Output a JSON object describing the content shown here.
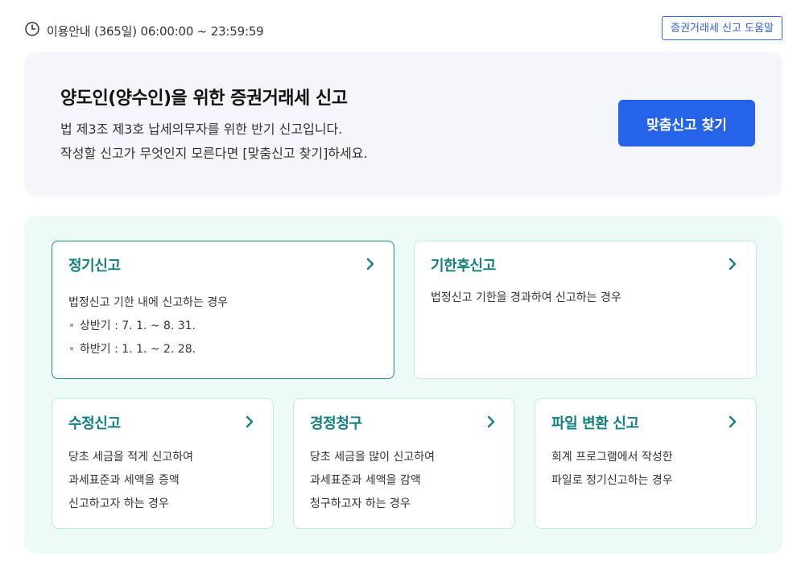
{
  "header": {
    "hours_text": "이용안내 (365일) 06:00:00 ~ 23:59:59",
    "help_button": "증권거래세 신고 도움말"
  },
  "hero": {
    "title": "양도인(양수인)을 위한 증권거래세 신고",
    "desc_line1": "법 제3조 제3호 납세의무자를 위한 반기 신고입니다.",
    "desc_line2": "작성할 신고가 무엇인지 모른다면 [맞춤신고 찾기]하세요.",
    "find_button": "맞춤신고 찾기"
  },
  "cards": [
    {
      "title": "정기신고",
      "lines": [
        "법정신고 기한 내에 신고하는 경우"
      ],
      "bullets": [
        "상반기 : 7. 1. ~ 8. 31.",
        "하반기 : 1. 1. ~ 2. 28."
      ]
    },
    {
      "title": "기한후신고",
      "lines": [
        "법정신고 기한을 경과하여 신고하는 경우"
      ]
    },
    {
      "title": "수정신고",
      "lines": [
        "당초 세금을 적게 신고하여",
        "과세표준과 세액을 증액",
        "신고하고자 하는 경우"
      ]
    },
    {
      "title": "경정청구",
      "lines": [
        "당초 세금을 많이 신고하여",
        "과세표준과 세액을 감액",
        "청구하고자 하는 경우"
      ]
    },
    {
      "title": "파일 변환 신고",
      "lines": [
        "회계 프로그램에서 작성한",
        "파일로 정기신고하는 경우"
      ]
    }
  ],
  "colors": {
    "accent_blue": "#2563e8",
    "card_title_teal": "#12807e",
    "panel_bg": "#eefaf8",
    "hero_bg": "#f4f6fa"
  },
  "icons": [
    "clock-icon",
    "chevron-right-icon"
  ]
}
